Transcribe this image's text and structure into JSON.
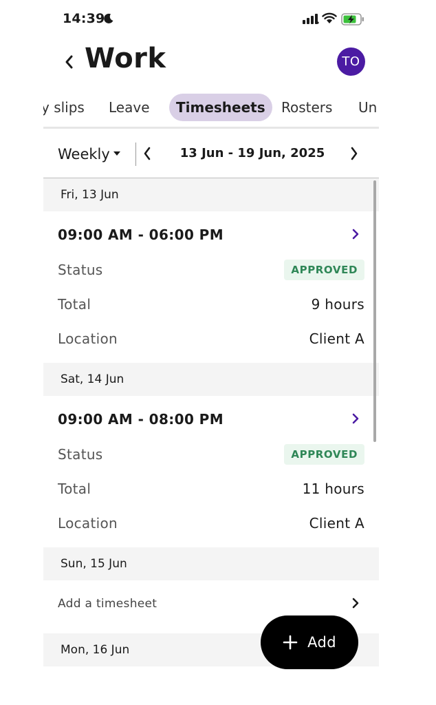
{
  "status_bar": {
    "time": "14:39"
  },
  "header": {
    "title": "Work",
    "avatar_initials": "TO"
  },
  "tabs": [
    {
      "label": "y slips"
    },
    {
      "label": "Leave"
    },
    {
      "label": "Timesheets",
      "active": true
    },
    {
      "label": "Rosters"
    },
    {
      "label": "Un"
    }
  ],
  "range": {
    "period": "Weekly",
    "label": "13 Jun - 19 Jun, 2025"
  },
  "days": [
    {
      "date": "Fri, 13 Jun",
      "shift": "09:00 AM - 06:00 PM",
      "status_label": "Status",
      "status": "APPROVED",
      "total_label": "Total",
      "total": "9 hours",
      "location_label": "Location",
      "location": "Client A"
    },
    {
      "date": "Sat, 14 Jun",
      "shift": "09:00 AM - 08:00 PM",
      "status_label": "Status",
      "status": "APPROVED",
      "total_label": "Total",
      "total": "11 hours",
      "location_label": "Location",
      "location": "Client A"
    },
    {
      "date": "Sun, 15 Jun",
      "add_label": "Add a timesheet"
    },
    {
      "date": "Mon, 16 Jun"
    }
  ],
  "fab": {
    "label": "Add"
  },
  "colors": {
    "accent": "#4b1ba3",
    "tab_active_bg": "#d9cfe6",
    "badge_bg": "#eaf6ee",
    "badge_text": "#2f8757"
  }
}
